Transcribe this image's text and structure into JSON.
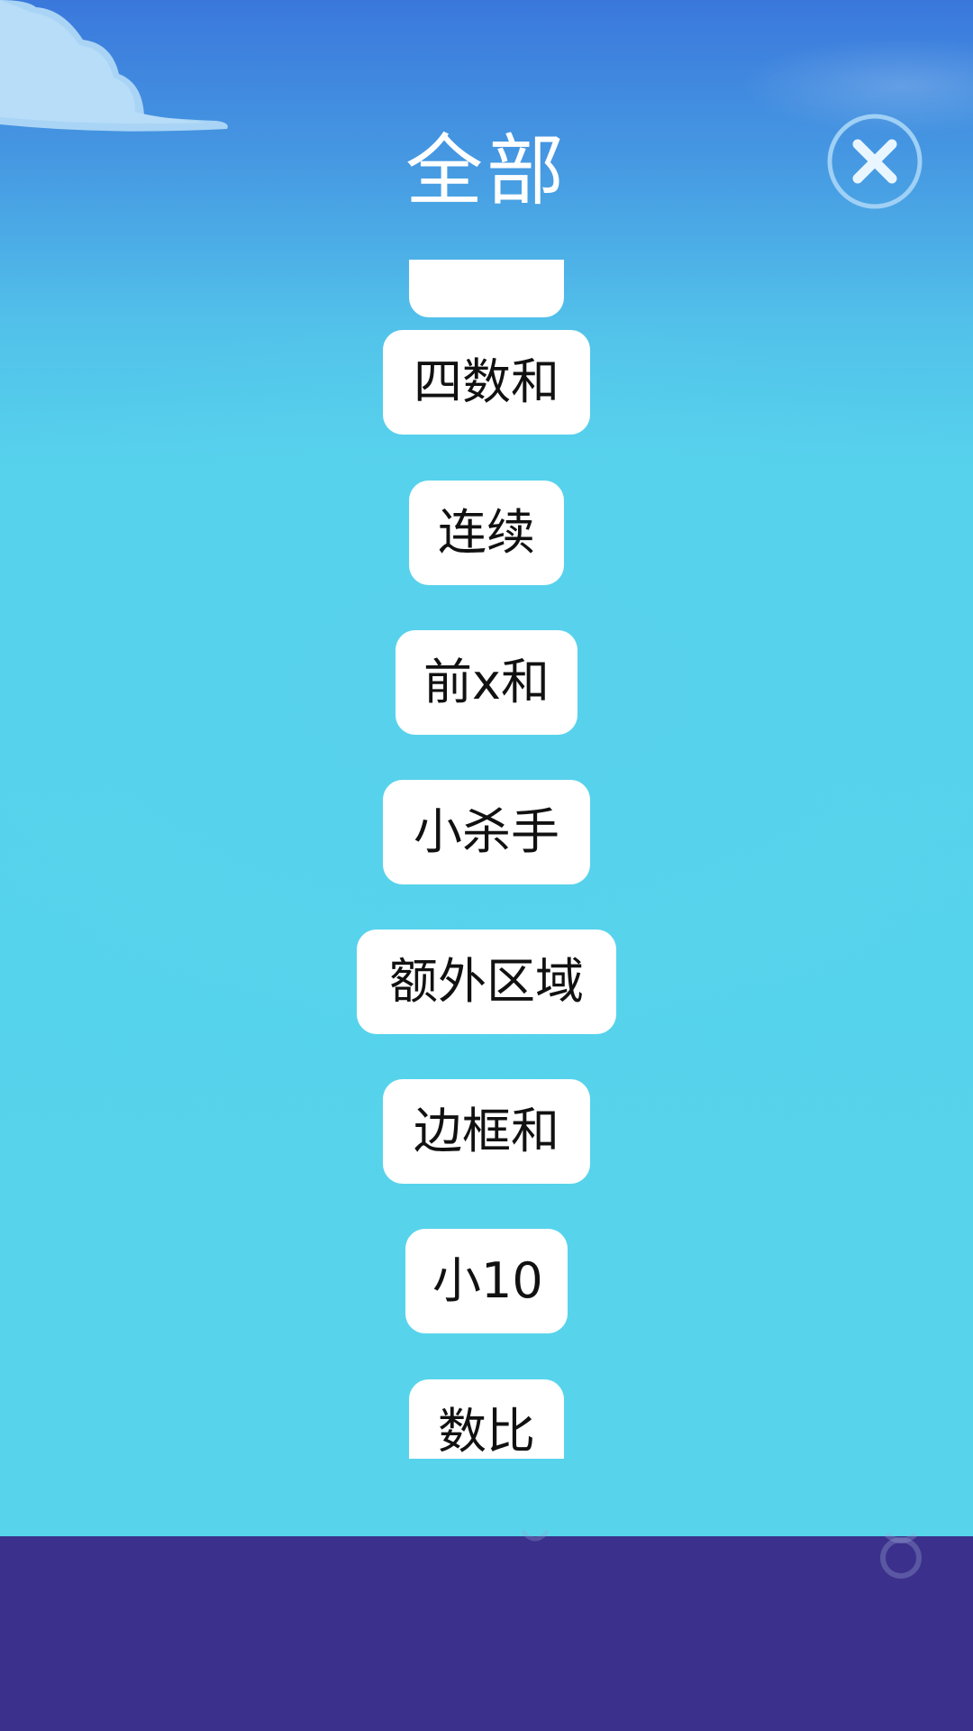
{
  "header": {
    "title": "全部"
  },
  "close_button": {
    "icon": "close-icon"
  },
  "categories": [
    "",
    "四数和",
    "连续",
    "前x和",
    "小杀手",
    "额外区域",
    "边框和",
    "小10",
    "数比"
  ],
  "colors": {
    "sky_top": "#3a78dc",
    "sky_bottom": "#57d4eb",
    "footer": "#3b308b",
    "pill": "#ffffff",
    "close_ring": "#9fd0f5"
  }
}
